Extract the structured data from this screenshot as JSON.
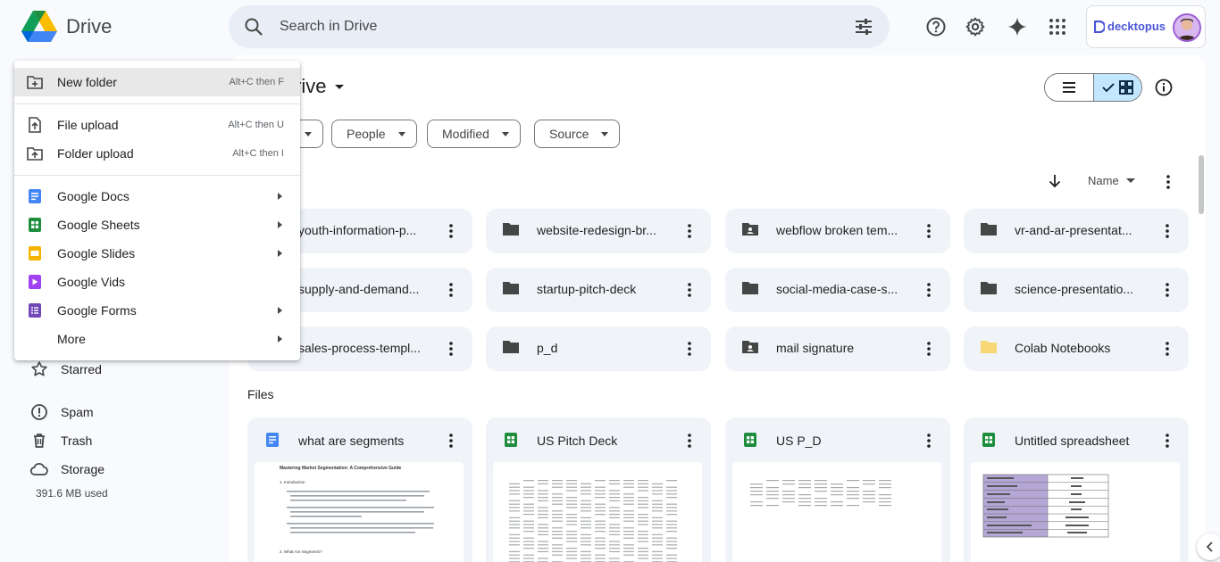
{
  "app": {
    "name": "Drive"
  },
  "search": {
    "placeholder": "Search in Drive"
  },
  "account": {
    "brand": "decktopus"
  },
  "sidebar": {
    "items": [
      {
        "label": "Starred",
        "icon": "star-icon"
      },
      {
        "label": "Spam",
        "icon": "spam-icon"
      },
      {
        "label": "Trash",
        "icon": "trash-icon"
      },
      {
        "label": "Storage",
        "icon": "cloud-icon"
      }
    ],
    "storage_used": "391.6 MB used"
  },
  "menu": {
    "items": [
      {
        "label": "New folder",
        "shortcut": "Alt+C then F",
        "icon": "new-folder-icon"
      },
      {
        "label": "File upload",
        "shortcut": "Alt+C then U",
        "icon": "file-upload-icon"
      },
      {
        "label": "Folder upload",
        "shortcut": "Alt+C then I",
        "icon": "folder-upload-icon"
      },
      {
        "label": "Google Docs",
        "icon": "google-docs-icon",
        "submenu": true
      },
      {
        "label": "Google Sheets",
        "icon": "google-sheets-icon",
        "submenu": true
      },
      {
        "label": "Google Slides",
        "icon": "google-slides-icon",
        "submenu": true
      },
      {
        "label": "Google Vids",
        "icon": "google-vids-icon"
      },
      {
        "label": "Google Forms",
        "icon": "google-forms-icon",
        "submenu": true
      },
      {
        "label": "More",
        "submenu": true
      }
    ]
  },
  "main": {
    "title": "rive",
    "filters": [
      "People",
      "Modified",
      "Source"
    ],
    "sort": {
      "label": "Name"
    },
    "folders": [
      {
        "name": "youth-information-p...",
        "type": "folder"
      },
      {
        "name": "website-redesign-br...",
        "type": "folder"
      },
      {
        "name": "webflow broken tem...",
        "type": "shared-folder"
      },
      {
        "name": "vr-and-ar-presentat...",
        "type": "folder"
      },
      {
        "name": "supply-and-demand...",
        "type": "folder"
      },
      {
        "name": "startup-pitch-deck",
        "type": "folder"
      },
      {
        "name": "social-media-case-s...",
        "type": "folder"
      },
      {
        "name": "science-presentatio...",
        "type": "folder"
      },
      {
        "name": "sales-process-templ...",
        "type": "folder"
      },
      {
        "name": "p_d",
        "type": "folder"
      },
      {
        "name": "mail signature",
        "type": "shared-folder"
      },
      {
        "name": "Colab Notebooks",
        "type": "yellow-folder"
      }
    ],
    "files_label": "Files",
    "files": [
      {
        "name": "what are segments",
        "type": "doc"
      },
      {
        "name": "US Pitch Deck",
        "type": "sheet"
      },
      {
        "name": "US P_D",
        "type": "sheet"
      },
      {
        "name": "Untitled spreadsheet",
        "type": "sheet"
      }
    ],
    "doc_preview": {
      "heading": "Mastering Market Segmentation: A Comprehensive Guide",
      "section1": "1. Introduction",
      "section2": "2. What Are Segments?"
    }
  },
  "colors": {
    "accent_blue": "#0b57d0",
    "docs_blue": "#4285f4",
    "sheets_green": "#1e8e3e",
    "slides_yellow": "#f4b400",
    "forms_purple": "#7248b9",
    "vids_purple": "#a142f4",
    "selected_toggle": "#c2e7ff"
  }
}
